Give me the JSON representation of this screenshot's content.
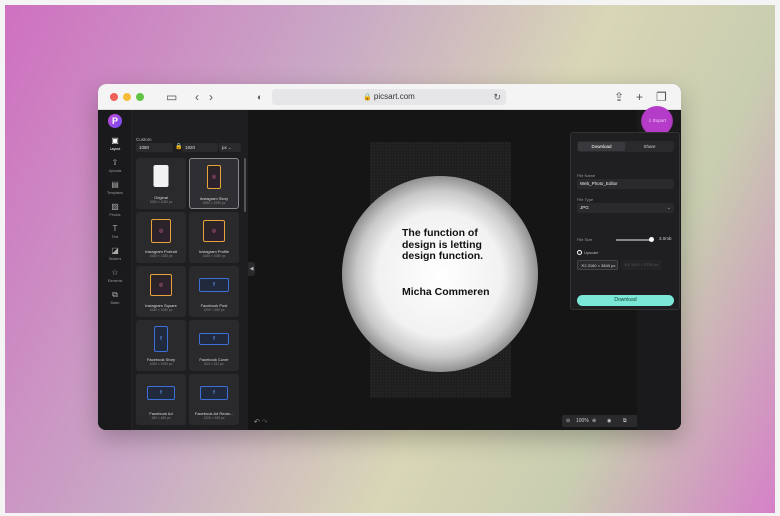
{
  "browser": {
    "url": "picsart.com",
    "lock_icon": "lock-icon",
    "reload_icon": "reload-icon"
  },
  "rail": {
    "logo": "P",
    "items": [
      {
        "label": "Layout",
        "icon": "layout-icon"
      },
      {
        "label": "Uploads",
        "icon": "upload-icon"
      },
      {
        "label": "Templates",
        "icon": "templates-icon"
      },
      {
        "label": "Photos",
        "icon": "photos-icon"
      },
      {
        "label": "Text",
        "icon": "text-icon"
      },
      {
        "label": "Stickers",
        "icon": "stickers-icon"
      },
      {
        "label": "Elements",
        "icon": "elements-icon"
      },
      {
        "label": "Batch",
        "icon": "batch-icon"
      }
    ]
  },
  "panel": {
    "title": "Custom",
    "width": "1080",
    "height": "1920",
    "unit": "px",
    "cards": [
      {
        "name": "Original",
        "size": "1080 × 1080 px",
        "kind": "orig"
      },
      {
        "name": "Instagram Story",
        "size": "1080 × 1920 px",
        "kind": "ig"
      },
      {
        "name": "Instagram Portrait",
        "size": "1080 × 1350 px",
        "kind": "ig"
      },
      {
        "name": "Instagram Profile",
        "size": "1080 × 1080 px",
        "kind": "ig"
      },
      {
        "name": "Instagram Square",
        "size": "1080 × 1080 px",
        "kind": "ig"
      },
      {
        "name": "Facebook Post",
        "size": "1200 × 630 px",
        "kind": "fb"
      },
      {
        "name": "Facebook Story",
        "size": "1080 × 1920 px",
        "kind": "fb"
      },
      {
        "name": "Facebook Cover",
        "size": "820 × 312 px",
        "kind": "fb"
      },
      {
        "name": "Facebook Ad",
        "size": "180 × 480 px",
        "kind": "fb"
      },
      {
        "name": "Facebook Ad Recta...",
        "size": "1200 × 628 px",
        "kind": "fb"
      }
    ]
  },
  "canvas": {
    "quote": "The function of design is letting design function.",
    "author": "Micha Commeren",
    "zoom": "100%"
  },
  "export": {
    "button_label": "Export",
    "tabs": [
      "Download",
      "Share"
    ],
    "file_name_label": "File Name",
    "file_name": "Web_Photo_Editor",
    "file_type_label": "File Type",
    "file_type": "JPG",
    "file_size_label": "File Size",
    "file_size": "3.0mb",
    "upscale_label": "Upscale",
    "upscale_2x": "2160 × 3840 px",
    "upscale_4x": "3240 × 5760 px",
    "download_label": "Download"
  }
}
